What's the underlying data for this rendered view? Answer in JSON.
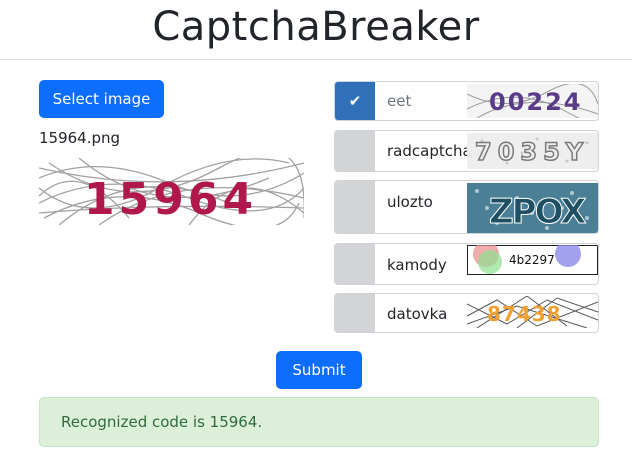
{
  "header": {
    "title": "CaptchaBreaker"
  },
  "upload": {
    "select_label": "Select image",
    "filename": "15964.png",
    "preview_text": "15964"
  },
  "options": [
    {
      "label": "eet",
      "selected": true,
      "check": "✔",
      "sample_text": "00224"
    },
    {
      "label": "radcaptcha",
      "selected": false,
      "sample_text": "7035Y"
    },
    {
      "label": "ulozto",
      "selected": false,
      "sample_text": "ZPOX"
    },
    {
      "label": "kamody",
      "selected": false,
      "sample_text": "4b2297"
    },
    {
      "label": "datovka",
      "selected": false,
      "sample_text": "87438"
    }
  ],
  "submit_label": "Submit",
  "result": {
    "message": "Recognized code is 15964."
  },
  "colors": {
    "primary": "#0d6efd",
    "selected_check": "#2f70b8",
    "success_bg": "#dcefd8",
    "success_text": "#306b3d"
  }
}
